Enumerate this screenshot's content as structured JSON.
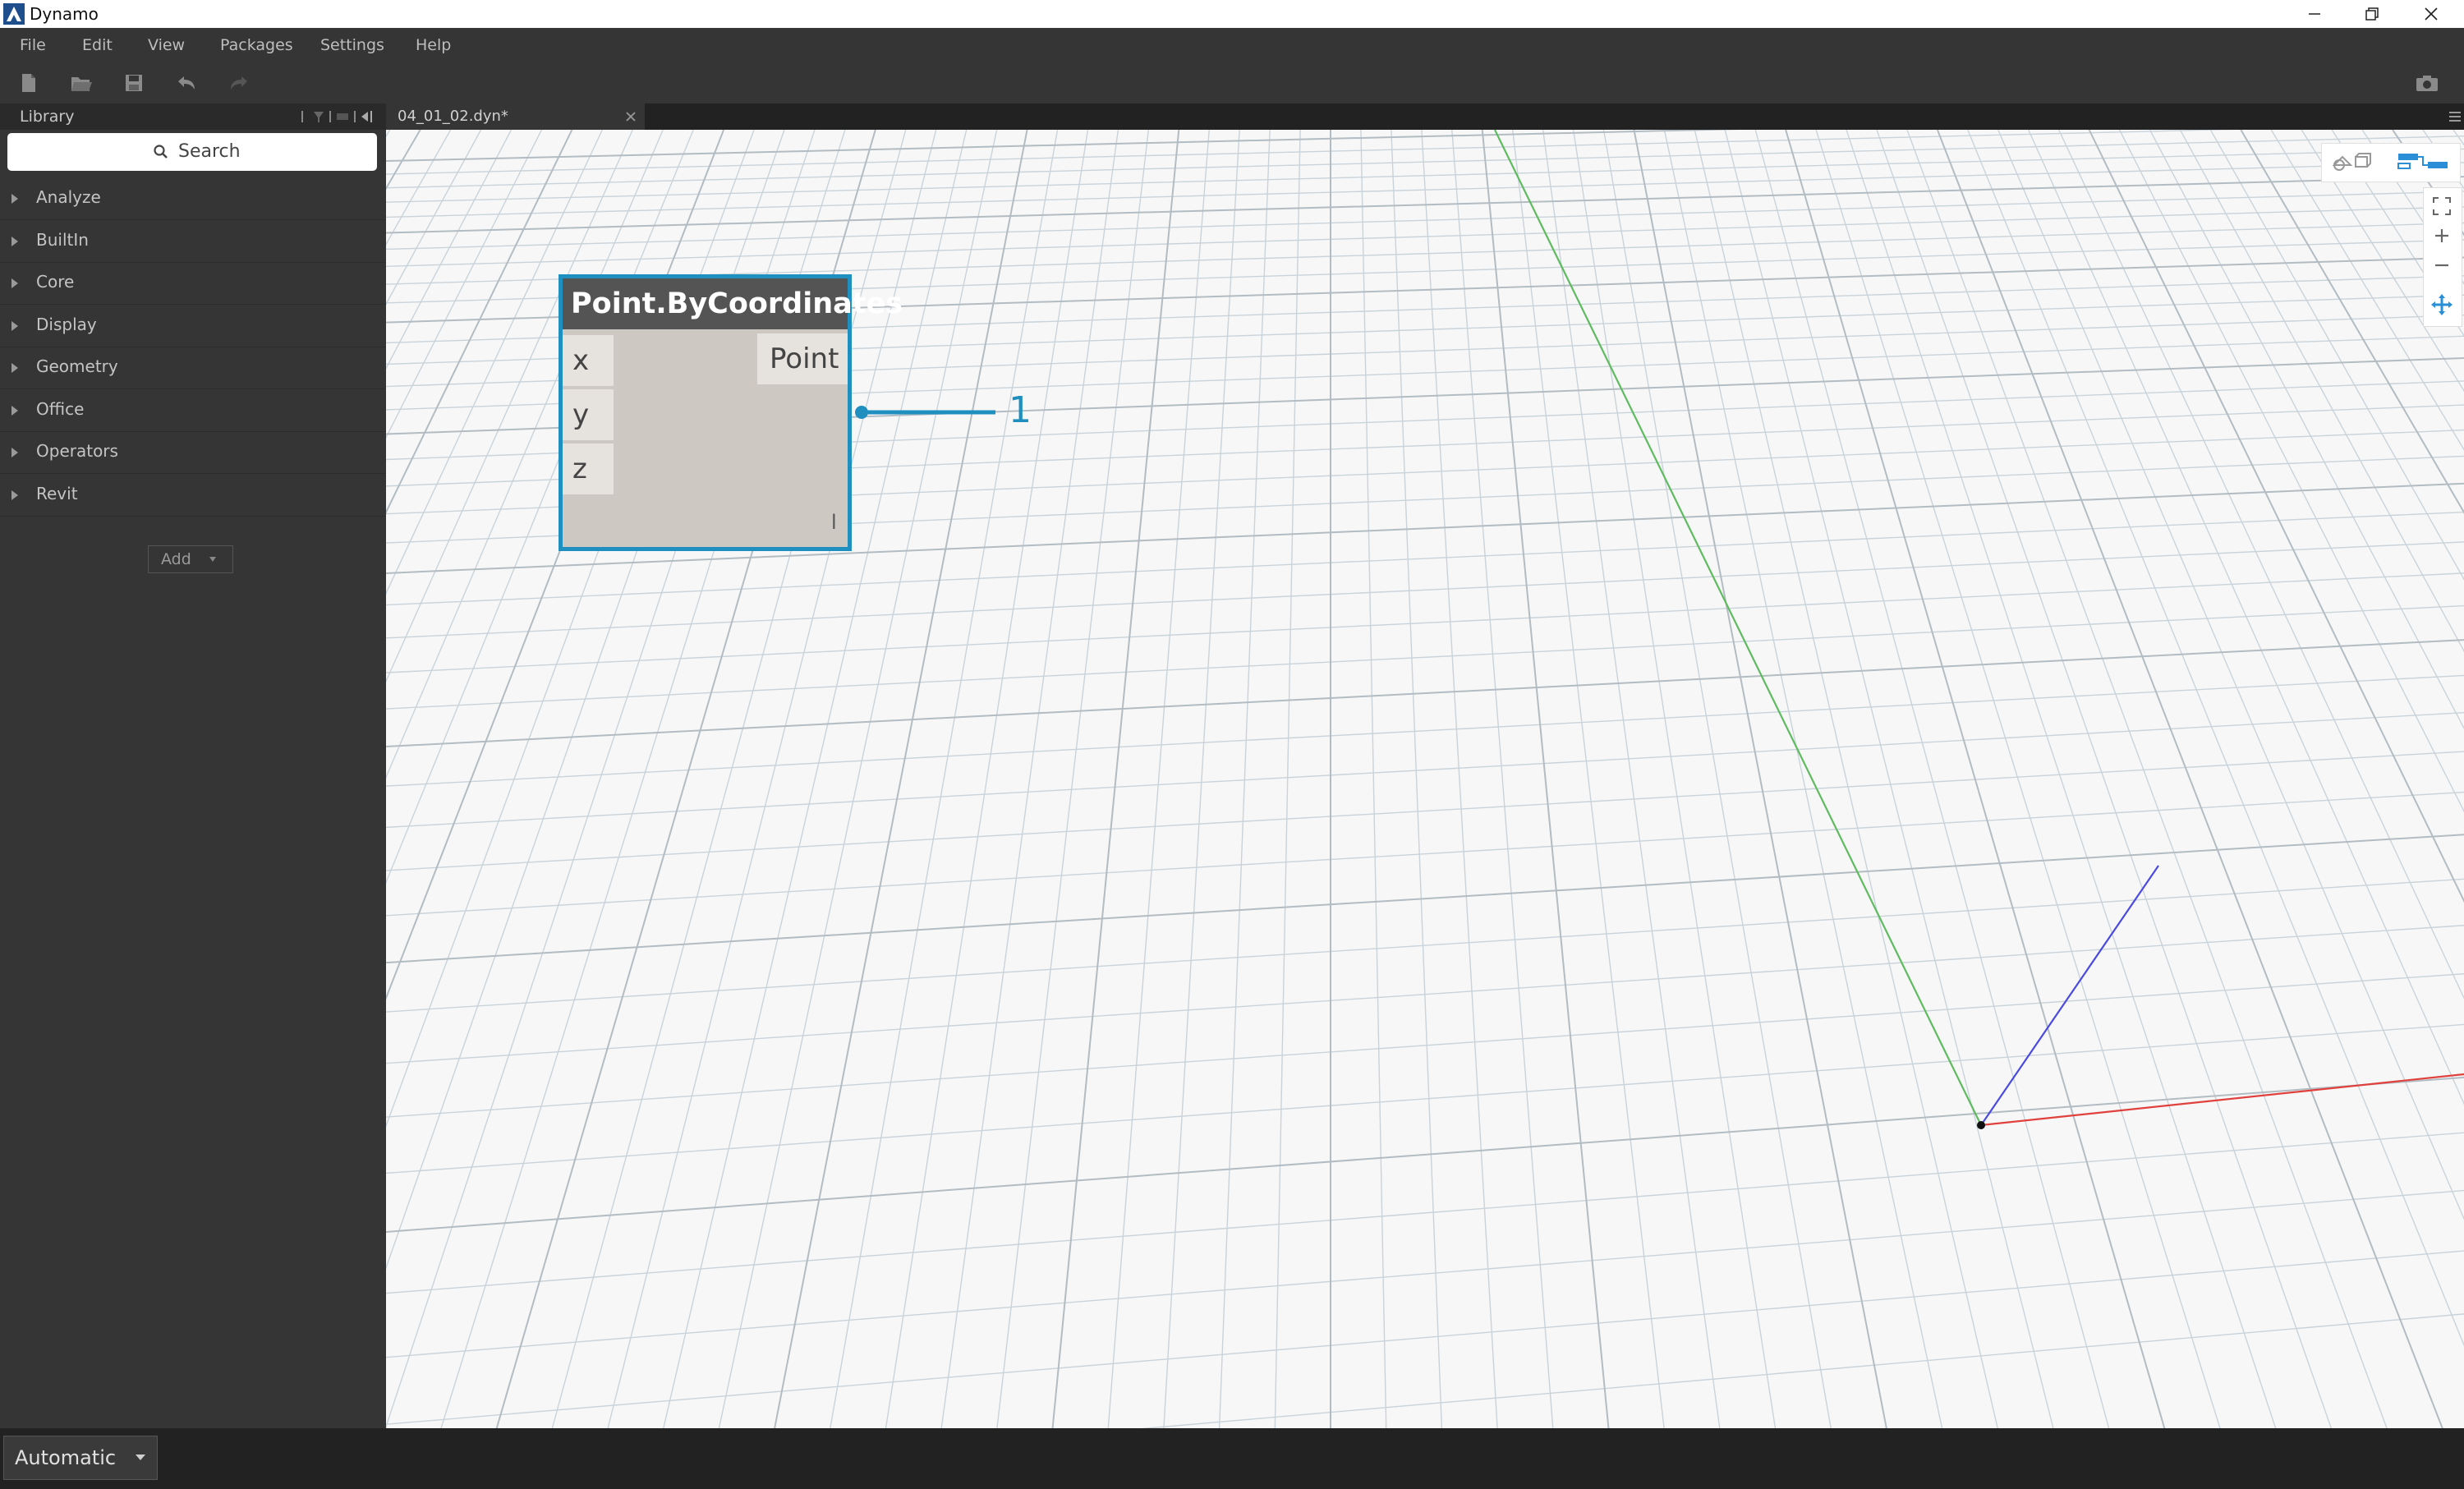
{
  "window": {
    "title": "Dynamo"
  },
  "menu": {
    "items": [
      "File",
      "Edit",
      "View",
      "Packages",
      "Settings",
      "Help"
    ]
  },
  "library": {
    "title": "Library",
    "search_placeholder": "Search",
    "categories": [
      "Analyze",
      "BuiltIn",
      "Core",
      "Display",
      "Geometry",
      "Office",
      "Operators",
      "Revit"
    ],
    "add_label": "Add"
  },
  "workspace": {
    "tab_label": "04_01_02.dyn*"
  },
  "node": {
    "title": "Point.ByCoordinates",
    "inputs": [
      "x",
      "y",
      "z"
    ],
    "output": "Point",
    "lacing": "l",
    "preview_value": "1"
  },
  "run": {
    "mode": "Automatic"
  },
  "colors": {
    "accent": "#1f8fc0",
    "axis_x": "#e0413d",
    "axis_y": "#4aa64a",
    "axis_z": "#4a4ae0"
  }
}
